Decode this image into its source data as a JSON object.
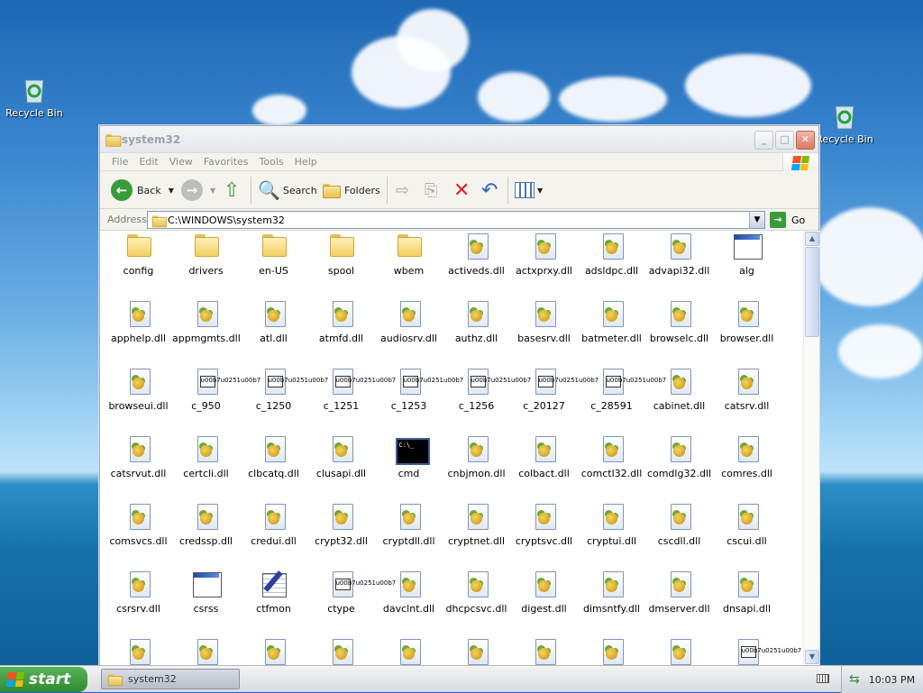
{
  "desktop": {
    "icons": [
      {
        "label": "Recycle Bin"
      },
      {
        "label": "Recycle Bin"
      }
    ]
  },
  "window": {
    "title": "system32",
    "menu": [
      "File",
      "Edit",
      "View",
      "Favorites",
      "Tools",
      "Help"
    ],
    "toolbar": {
      "back": "Back",
      "search": "Search",
      "folders": "Folders"
    },
    "address": {
      "label": "Address",
      "path": "C:\\WINDOWS\\system32",
      "go": "Go"
    },
    "items": [
      {
        "name": "config",
        "type": "folder"
      },
      {
        "name": "drivers",
        "type": "folder"
      },
      {
        "name": "en-US",
        "type": "folder"
      },
      {
        "name": "spool",
        "type": "folder"
      },
      {
        "name": "wbem",
        "type": "folder"
      },
      {
        "name": "activeds.dll",
        "type": "dll"
      },
      {
        "name": "actxprxy.dll",
        "type": "dll"
      },
      {
        "name": "adsldpc.dll",
        "type": "dll"
      },
      {
        "name": "advapi32.dll",
        "type": "dll"
      },
      {
        "name": "alg",
        "type": "app"
      },
      {
        "name": "apphelp.dll",
        "type": "dll"
      },
      {
        "name": "appmgmts.dll",
        "type": "dll"
      },
      {
        "name": "atl.dll",
        "type": "dll"
      },
      {
        "name": "atmfd.dll",
        "type": "dll"
      },
      {
        "name": "audiosrv.dll",
        "type": "dll"
      },
      {
        "name": "authz.dll",
        "type": "dll"
      },
      {
        "name": "basesrv.dll",
        "type": "dll"
      },
      {
        "name": "batmeter.dll",
        "type": "dll"
      },
      {
        "name": "browselc.dll",
        "type": "dll"
      },
      {
        "name": "browser.dll",
        "type": "dll"
      },
      {
        "name": "browseui.dll",
        "type": "dll"
      },
      {
        "name": "c_950",
        "type": "nls"
      },
      {
        "name": "c_1250",
        "type": "nls"
      },
      {
        "name": "c_1251",
        "type": "nls"
      },
      {
        "name": "c_1253",
        "type": "nls"
      },
      {
        "name": "c_1256",
        "type": "nls"
      },
      {
        "name": "c_20127",
        "type": "nls"
      },
      {
        "name": "c_28591",
        "type": "nls"
      },
      {
        "name": "cabinet.dll",
        "type": "dll"
      },
      {
        "name": "catsrv.dll",
        "type": "dll"
      },
      {
        "name": "catsrvut.dll",
        "type": "dll"
      },
      {
        "name": "certcli.dll",
        "type": "dll"
      },
      {
        "name": "clbcatq.dll",
        "type": "dll"
      },
      {
        "name": "clusapi.dll",
        "type": "dll"
      },
      {
        "name": "cmd",
        "type": "cmd"
      },
      {
        "name": "cnbjmon.dll",
        "type": "dll"
      },
      {
        "name": "colbact.dll",
        "type": "dll"
      },
      {
        "name": "comctl32.dll",
        "type": "dll"
      },
      {
        "name": "comdlg32.dll",
        "type": "dll"
      },
      {
        "name": "comres.dll",
        "type": "dll"
      },
      {
        "name": "comsvcs.dll",
        "type": "dll"
      },
      {
        "name": "credssp.dll",
        "type": "dll"
      },
      {
        "name": "credui.dll",
        "type": "dll"
      },
      {
        "name": "crypt32.dll",
        "type": "dll"
      },
      {
        "name": "cryptdll.dll",
        "type": "dll"
      },
      {
        "name": "cryptnet.dll",
        "type": "dll"
      },
      {
        "name": "cryptsvc.dll",
        "type": "dll"
      },
      {
        "name": "cryptui.dll",
        "type": "dll"
      },
      {
        "name": "cscdll.dll",
        "type": "dll"
      },
      {
        "name": "cscui.dll",
        "type": "dll"
      },
      {
        "name": "csrsrv.dll",
        "type": "dll"
      },
      {
        "name": "csrss",
        "type": "app"
      },
      {
        "name": "ctfmon",
        "type": "pen"
      },
      {
        "name": "ctype",
        "type": "nls"
      },
      {
        "name": "davclnt.dll",
        "type": "dll"
      },
      {
        "name": "dhcpcsvc.dll",
        "type": "dll"
      },
      {
        "name": "digest.dll",
        "type": "dll"
      },
      {
        "name": "dimsntfy.dll",
        "type": "dll"
      },
      {
        "name": "dmserver.dll",
        "type": "dll"
      },
      {
        "name": "dnsapi.dll",
        "type": "dll"
      },
      {
        "name": "",
        "type": "dll"
      },
      {
        "name": "",
        "type": "dll"
      },
      {
        "name": "",
        "type": "dll"
      },
      {
        "name": "",
        "type": "dll"
      },
      {
        "name": "",
        "type": "dll"
      },
      {
        "name": "",
        "type": "dll"
      },
      {
        "name": "",
        "type": "dll"
      },
      {
        "name": "",
        "type": "dll"
      },
      {
        "name": "",
        "type": "dll"
      },
      {
        "name": "",
        "type": "nls"
      }
    ]
  },
  "taskbar": {
    "start": "start",
    "task": "system32",
    "clock": "10:03 PM"
  }
}
